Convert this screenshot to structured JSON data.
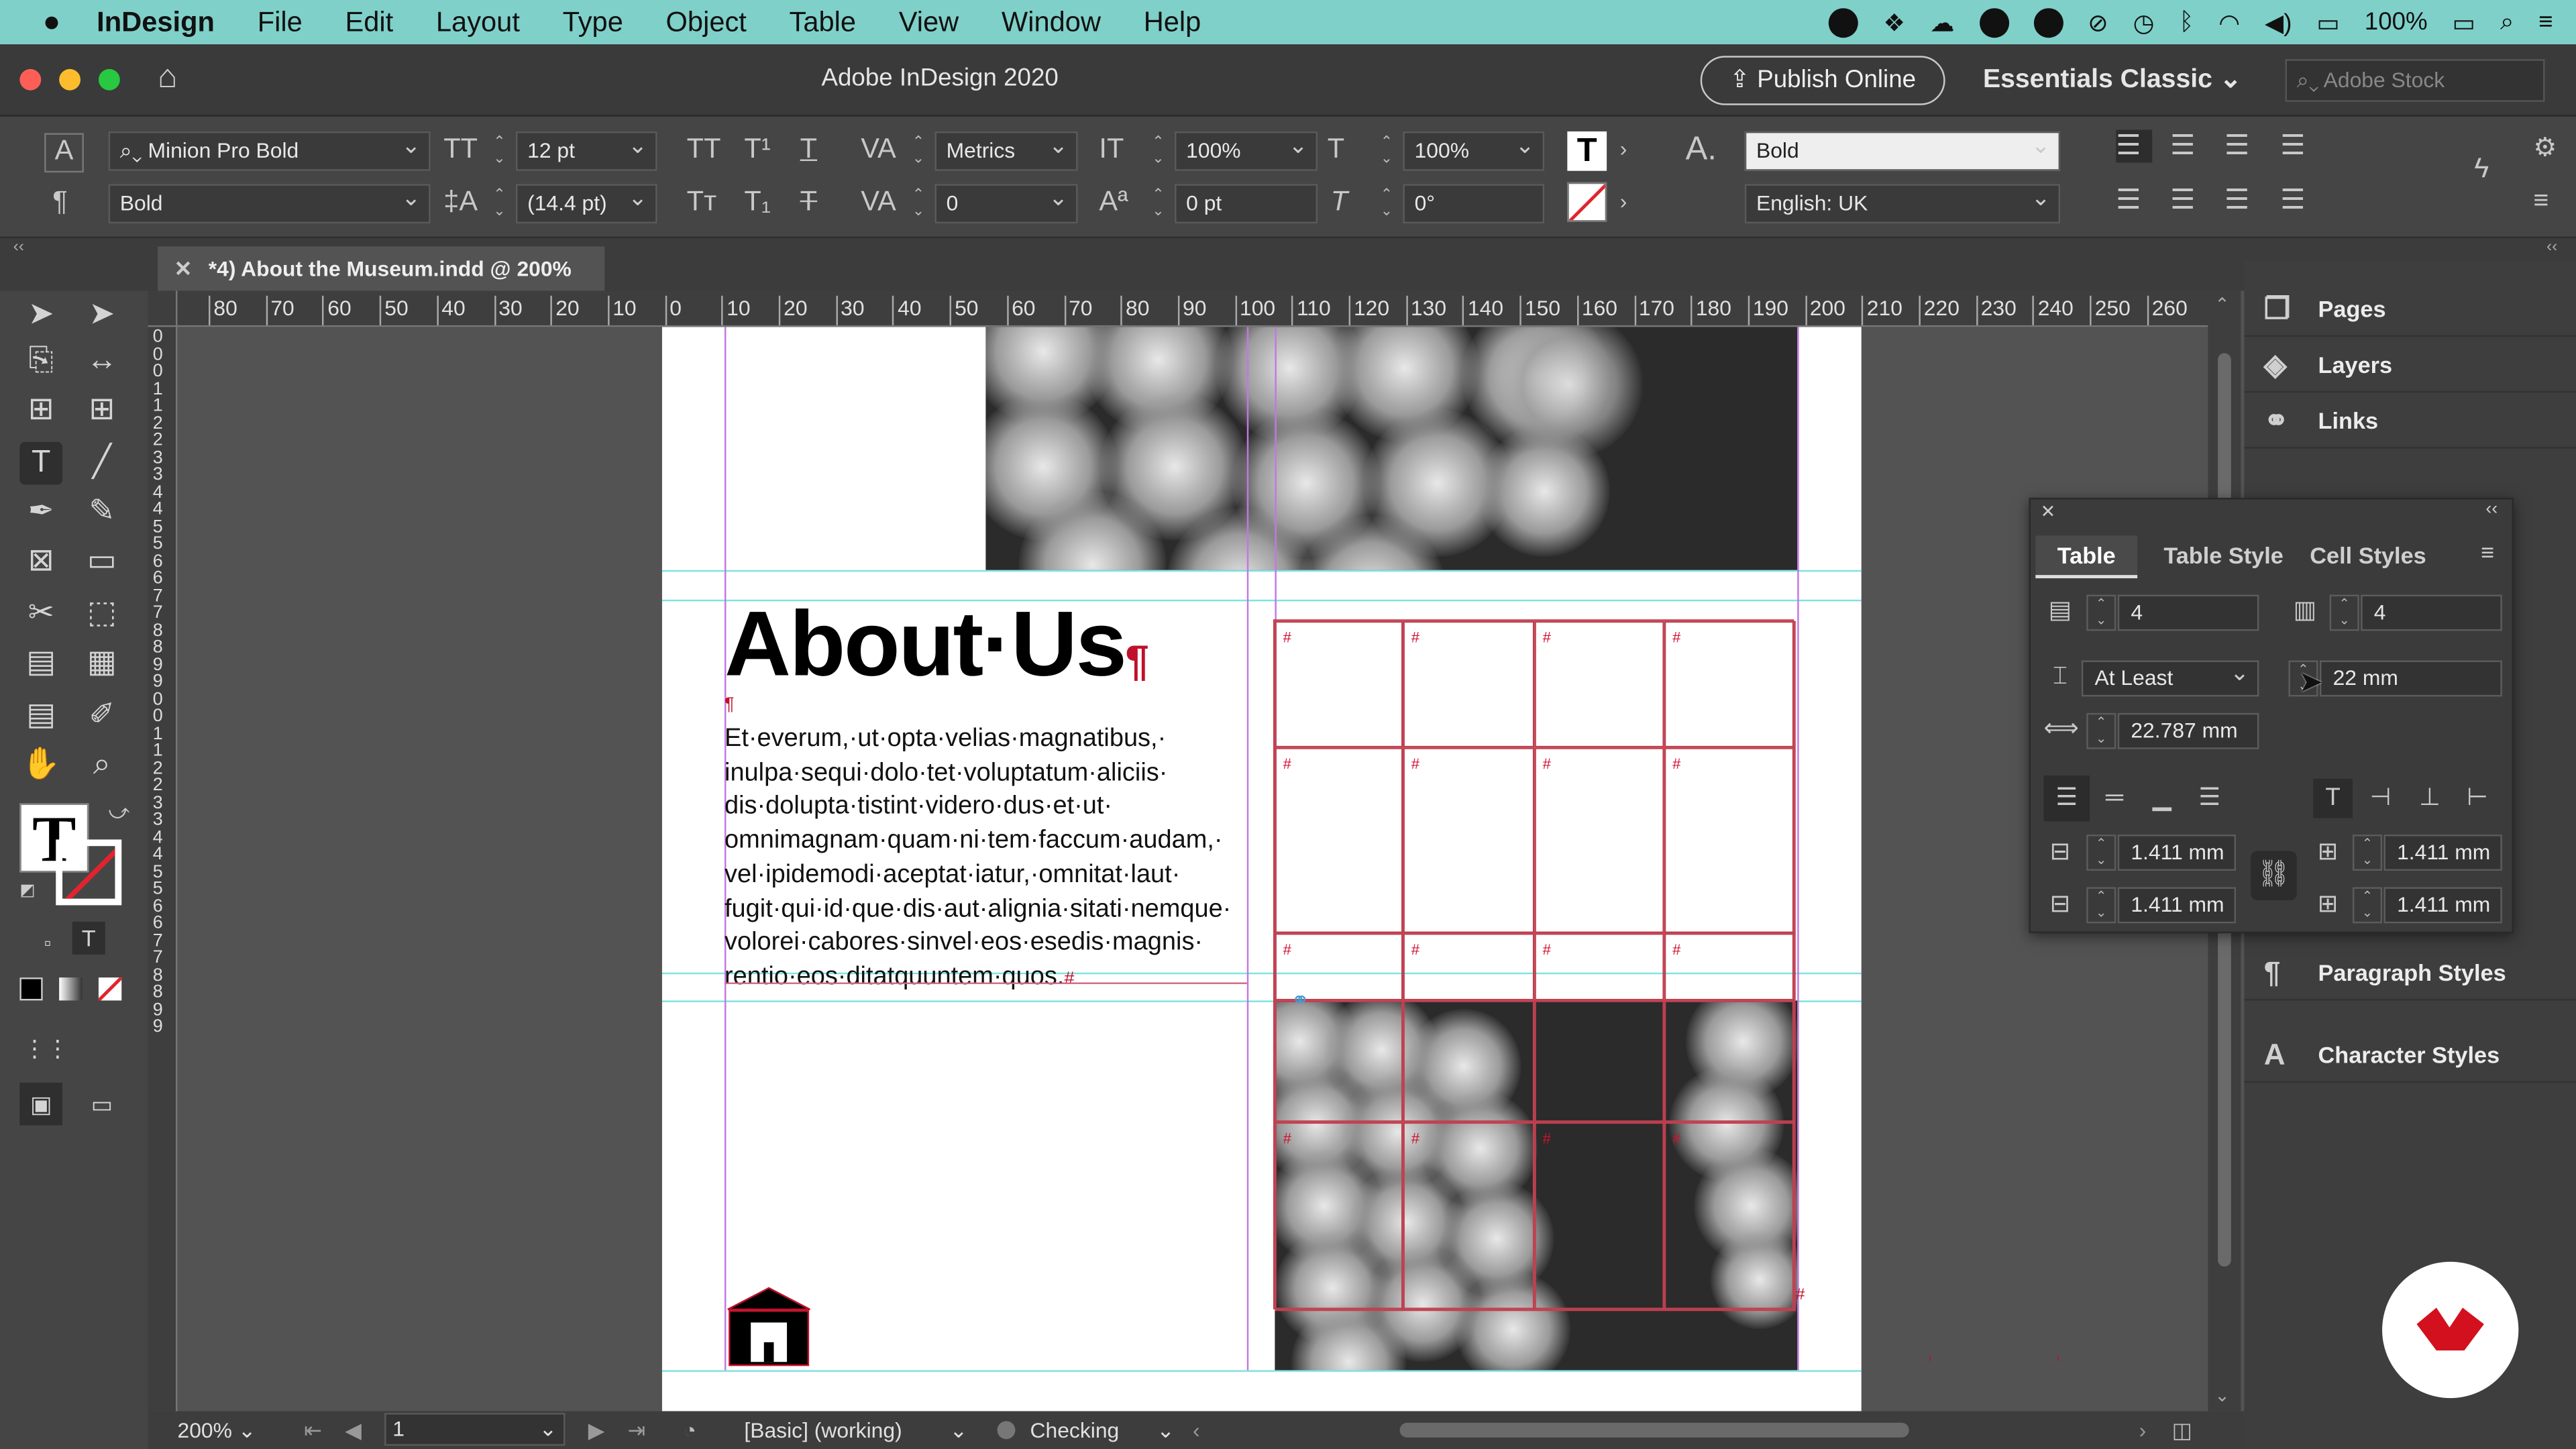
{
  "menubar": {
    "app": "InDesign",
    "items": [
      "File",
      "Edit",
      "Layout",
      "Type",
      "Object",
      "Table",
      "View",
      "Window",
      "Help"
    ],
    "battery": "100%"
  },
  "titlebar": {
    "title": "Adobe InDesign 2020",
    "publish": "Publish Online",
    "workspace": "Essentials Classic",
    "stock_placeholder": "Adobe Stock"
  },
  "control": {
    "font": "Minion Pro Bold",
    "style": "Bold",
    "size": "12 pt",
    "leading": "(14.4 pt)",
    "kerning": "Metrics",
    "tracking": "0",
    "vscale": "100%",
    "hscale": "100%",
    "baseline": "0 pt",
    "skew": "0°",
    "char_style": "Bold",
    "language": "English: UK"
  },
  "doc_tab": "*4) About the Museum.indd @ 200%",
  "ruler_h": [
    "80",
    "70",
    "60",
    "50",
    "40",
    "30",
    "20",
    "10",
    "0",
    "10",
    "20",
    "30",
    "40",
    "50",
    "60",
    "70",
    "80",
    "90",
    "100",
    "110",
    "120",
    "130",
    "140",
    "150",
    "160",
    "170",
    "180",
    "190",
    "200",
    "210",
    "220",
    "230",
    "240",
    "250",
    "260"
  ],
  "ruler_v": [
    "0",
    "0",
    "0",
    "1",
    "1",
    "2",
    "2",
    "3",
    "3",
    "4",
    "4",
    "5",
    "5",
    "6",
    "6",
    "7",
    "7",
    "8",
    "8",
    "9",
    "9",
    "0",
    "0",
    "1",
    "1",
    "2",
    "2",
    "3",
    "3",
    "4",
    "4",
    "5",
    "5",
    "6",
    "6",
    "7",
    "7",
    "8",
    "8",
    "9",
    "9"
  ],
  "page": {
    "heading": "About·Us",
    "pilcrow": "¶",
    "body": [
      "Et·everum,·ut·opta·velias·magnatibus,·",
      "inulpa·sequi·dolo·tet·voluptatum·aliciis·",
      "dis·dolupta·tistint·videro·dus·et·ut·",
      "omnimagnam·quam·ni·tem·faccum·audam,·",
      "vel·ipidemodi·aceptat·iatur,·omnitat·laut·",
      "fugit·qui·id·que·dis·aut·alignia·sitati·nemque·",
      "volorei·cabores·sinvel·eos·esedis·magnis·",
      "rentio·eos·ditatquuntem·quos."
    ],
    "hash": "#"
  },
  "panels": {
    "items": [
      "Pages",
      "Layers",
      "Links",
      "Paragraph Styles",
      "Character Styles"
    ]
  },
  "table_panel": {
    "tabs": [
      "Table",
      "Table Style",
      "Cell Styles"
    ],
    "rows": "4",
    "cols": "4",
    "row_height_mode": "At Least",
    "row_height": "22 mm",
    "col_width": "22.787 mm",
    "inset_top": "1.411 mm",
    "inset_bottom": "1.411 mm",
    "inset_left": "1.411 mm",
    "inset_right": "1.411 mm"
  },
  "status": {
    "zoom": "200%",
    "page": "1",
    "style": "[Basic] (working)",
    "preflight": "Checking"
  },
  "colors": {
    "menubar": "#7fd0c9",
    "table_stroke": "#c04050",
    "guide": "#7fe2e2",
    "margin": "#c278e2"
  }
}
